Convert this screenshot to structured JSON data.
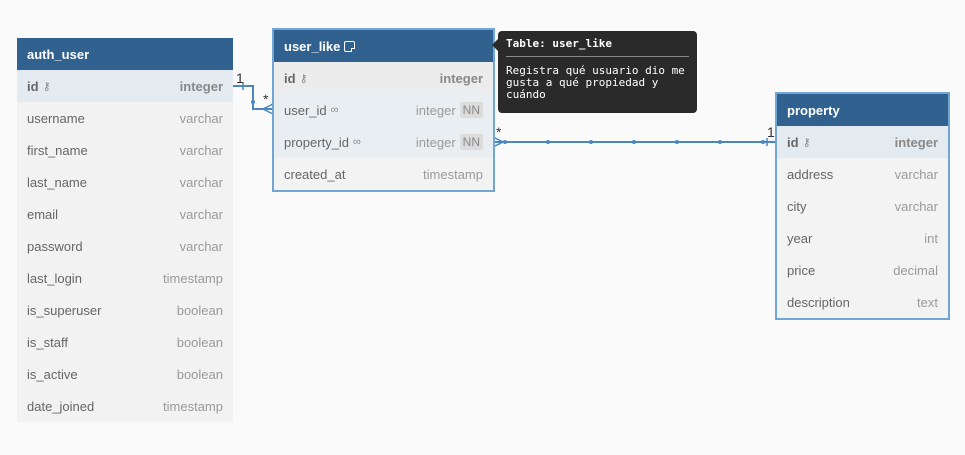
{
  "tables": {
    "auth_user": {
      "name": "auth_user",
      "rows": [
        {
          "name": "id",
          "type": "integer"
        },
        {
          "name": "username",
          "type": "varchar"
        },
        {
          "name": "first_name",
          "type": "varchar"
        },
        {
          "name": "last_name",
          "type": "varchar"
        },
        {
          "name": "email",
          "type": "varchar"
        },
        {
          "name": "password",
          "type": "varchar"
        },
        {
          "name": "last_login",
          "type": "timestamp"
        },
        {
          "name": "is_superuser",
          "type": "boolean"
        },
        {
          "name": "is_staff",
          "type": "boolean"
        },
        {
          "name": "is_active",
          "type": "boolean"
        },
        {
          "name": "date_joined",
          "type": "timestamp"
        }
      ]
    },
    "user_like": {
      "name": "user_like",
      "rows": [
        {
          "name": "id",
          "type": "integer"
        },
        {
          "name": "user_id",
          "type": "integer",
          "badge": "NN"
        },
        {
          "name": "property_id",
          "type": "integer",
          "badge": "NN"
        },
        {
          "name": "created_at",
          "type": "timestamp"
        }
      ]
    },
    "property": {
      "name": "property",
      "rows": [
        {
          "name": "id",
          "type": "integer"
        },
        {
          "name": "address",
          "type": "varchar"
        },
        {
          "name": "city",
          "type": "varchar"
        },
        {
          "name": "year",
          "type": "int"
        },
        {
          "name": "price",
          "type": "decimal"
        },
        {
          "name": "description",
          "type": "text"
        }
      ]
    }
  },
  "tooltip": {
    "title": "Table: user_like",
    "body": "Registra qué usuario dio me gusta a qué propiedad y cuándo"
  },
  "relations": {
    "rel1_one": "1",
    "rel1_many": "*",
    "rel2_many": "*",
    "rel2_one": "1"
  },
  "colors": {
    "header": "#31628f",
    "selected_outline": "#6fa6d6",
    "link": "#4a86c0"
  }
}
